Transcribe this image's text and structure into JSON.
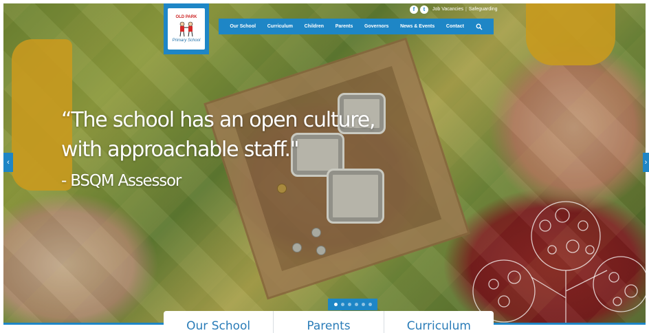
{
  "brand": {
    "logo_top": "OLD PARK",
    "logo_bottom": "Primary School",
    "accent_color": "#1e86c6"
  },
  "topbar": {
    "social": [
      {
        "icon": "facebook-icon",
        "glyph": "f"
      },
      {
        "icon": "twitter-icon",
        "glyph": "t"
      }
    ],
    "links": [
      "Job Vacancies",
      "Safeguarding"
    ]
  },
  "nav": {
    "items": [
      "Our School",
      "Curriculum",
      "Children",
      "Parents",
      "Governors",
      "News & Events",
      "Contact"
    ],
    "search_icon": "search-icon"
  },
  "hero": {
    "quote_line1": "“The school has an open culture,",
    "quote_line2": "with approachable staff.\"",
    "author": "- BSQM Assessor",
    "prev_glyph": "‹",
    "next_glyph": "›",
    "slides_total": 6,
    "slides_active": 1
  },
  "quick_tabs": [
    "Our School",
    "Parents",
    "Curriculum"
  ]
}
